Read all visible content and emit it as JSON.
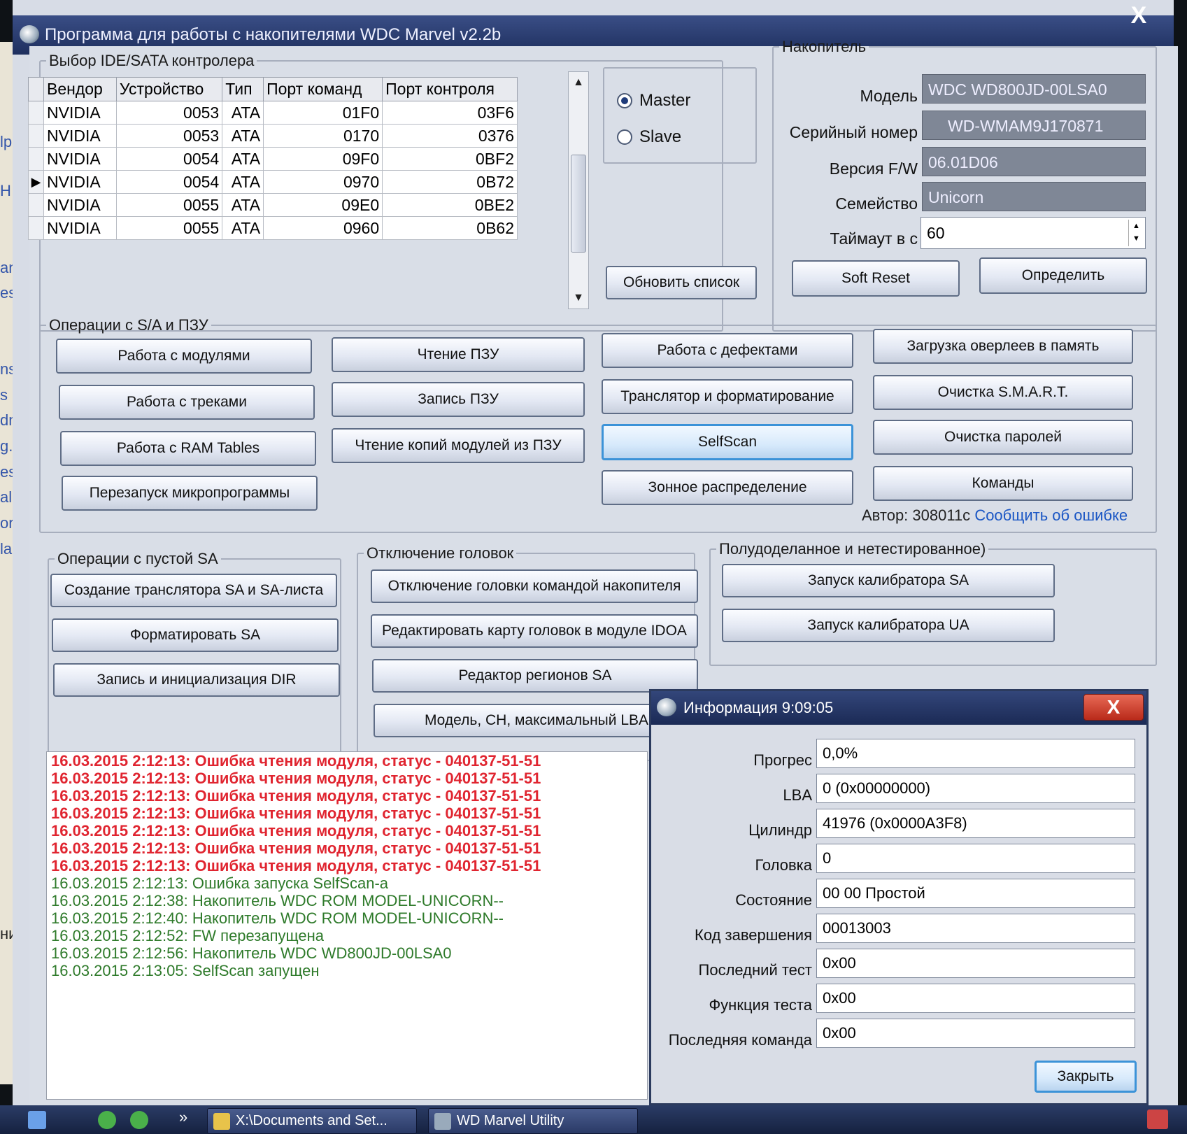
{
  "window": {
    "title": "Программа для работы с накопителями WDC Marvel v2.2b",
    "close": "X"
  },
  "desktop_strip": [
    "lpa",
    "H",
    "and",
    "es",
    "ns",
    "s",
    "dmm",
    "g.ini",
    "esc",
    "alk.s",
    "ors.i",
    "larv.",
    "ние: W"
  ],
  "controller": {
    "legend": "Выбор IDE/SATA контролера",
    "columns": [
      "Вендор",
      "Устройство",
      "Тип",
      "Порт команд",
      "Порт контроля"
    ],
    "rows": [
      [
        "NVIDIA",
        "0053",
        "ATA",
        "01F0",
        "03F6"
      ],
      [
        "NVIDIA",
        "0053",
        "ATA",
        "0170",
        "0376"
      ],
      [
        "NVIDIA",
        "0054",
        "ATA",
        "09F0",
        "0BF2"
      ],
      [
        "NVIDIA",
        "0054",
        "ATA",
        "0970",
        "0B72"
      ],
      [
        "NVIDIA",
        "0055",
        "ATA",
        "09E0",
        "0BE2"
      ],
      [
        "NVIDIA",
        "0055",
        "ATA",
        "0960",
        "0B62"
      ]
    ],
    "selected_row_marker": "▶",
    "master": "Master",
    "slave": "Slave",
    "refresh": "Обновить список"
  },
  "drive": {
    "legend": "Накопитель",
    "model_label": "Модель",
    "model": "WDC WD800JD-00LSA0",
    "serial_label": "Серийный номер",
    "serial": "WD-WMAM9J170871",
    "fw_label": "Версия F/W",
    "fw": "06.01D06",
    "family_label": "Семейство",
    "family": "Unicorn",
    "timeout_label": "Таймаут в с",
    "timeout": "60",
    "soft_reset": "Soft Reset",
    "detect": "Определить"
  },
  "ops": {
    "legend": "Операции с S/A и ПЗУ",
    "col1": [
      "Работа с модулями",
      "Работа с треками",
      "Работа с RAM Tables",
      "Перезапуск микропрограммы"
    ],
    "col2": [
      "Чтение ПЗУ",
      "Запись ПЗУ",
      "Чтение копий модулей из ПЗУ"
    ],
    "col3": [
      "Работа с дефектами",
      "Транслятор и форматирование",
      "SelfScan",
      "Зонное распределение"
    ],
    "col4": [
      "Загрузка оверлеев в память",
      "Очистка S.M.A.R.T.",
      "Очистка паролей",
      "Команды"
    ],
    "author": "Автор: 308011c",
    "report": "Сообщить об ошибке"
  },
  "empty_sa": {
    "legend": "Операции с пустой SA",
    "buttons": [
      "Создание транслятора SA и SA-листа",
      "Форматировать SA",
      "Запись и инициализация DIR"
    ]
  },
  "heads": {
    "legend": "Отключение головок",
    "buttons": [
      "Отключение головки командой накопителя",
      "Редактировать карту головок в модуле IDOA",
      "Редактор регионов SA",
      "Модель, СН, максимальный LBA"
    ]
  },
  "experimental": {
    "legend": "Полудоделанное и нетестированное)",
    "buttons": [
      "Запуск калибратора SA",
      "Запуск калибратора UA"
    ]
  },
  "log": {
    "errors": [
      "16.03.2015 2:12:13: Ошибка чтения модуля, статус - 040137-51-51",
      "16.03.2015 2:12:13: Ошибка чтения модуля, статус - 040137-51-51",
      "16.03.2015 2:12:13: Ошибка чтения модуля, статус - 040137-51-51",
      "16.03.2015 2:12:13: Ошибка чтения модуля, статус - 040137-51-51",
      "16.03.2015 2:12:13: Ошибка чтения модуля, статус - 040137-51-51",
      "16.03.2015 2:12:13: Ошибка чтения модуля, статус - 040137-51-51",
      "16.03.2015 2:12:13: Ошибка чтения модуля, статус - 040137-51-51"
    ],
    "info": [
      "16.03.2015 2:12:13: Ошибка запуска SelfScan-a",
      "16.03.2015 2:12:38: Накопитель WDC ROM MODEL-UNICORN--",
      "16.03.2015 2:12:40: Накопитель WDC ROM MODEL-UNICORN--",
      "16.03.2015 2:12:52: FW перезапущена",
      "16.03.2015 2:12:56: Накопитель WDC WD800JD-00LSA0",
      "16.03.2015 2:13:05: SelfScan запущен"
    ]
  },
  "info_dialog": {
    "title": "Информация 9:09:05",
    "close": "X",
    "rows": [
      {
        "label": "Прогрес",
        "value": "0,0%"
      },
      {
        "label": "LBA",
        "value": "0 (0x00000000)"
      },
      {
        "label": "Цилиндр",
        "value": "41976 (0x0000A3F8)"
      },
      {
        "label": "Головка",
        "value": "0"
      },
      {
        "label": "Состояние",
        "value": "00 00 Простой"
      },
      {
        "label": "Код завершения",
        "value": "00013003"
      },
      {
        "label": "Последний тест",
        "value": "0x00"
      },
      {
        "label": "Функция теста",
        "value": "0x00"
      },
      {
        "label": "Последняя команда",
        "value": "0x00"
      }
    ],
    "close_button": "Закрыть"
  },
  "taskbar": {
    "chevron": "»",
    "items": [
      "X:\\Documents and Set...",
      "WD Marvel Utility"
    ]
  },
  "colors": {
    "error": "#e02530",
    "ok": "#2e7a2a",
    "link": "#1a56c4",
    "title": "#1e2f5e"
  }
}
